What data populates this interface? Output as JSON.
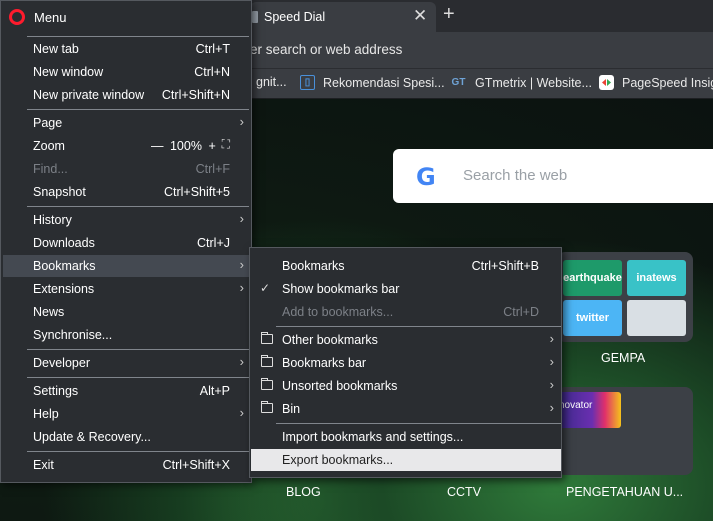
{
  "browser": {
    "tab_title": "Speed Dial",
    "tab_close": "✕",
    "new_tab_symbol": "+",
    "address_placeholder": "er search or web address",
    "bookmarks_bar": [
      {
        "label": "gnit...",
        "icon": "page-icon",
        "color": "#9aa3ad"
      },
      {
        "label": "Rekomendasi Spesi...",
        "icon": "doc-icon",
        "color": "#4a90d9"
      },
      {
        "label": "GTmetrix | Website...",
        "icon": "gtmetrix-icon",
        "glyph": "GT",
        "color": "#3a6ea5"
      },
      {
        "label": "PageSpeed Insigh",
        "icon": "pagespeed-icon",
        "color": "#34a853"
      }
    ]
  },
  "speed_dial": {
    "search_placeholder": "Search the web",
    "logo_letter": "G",
    "folder_tiles": [
      {
        "label": "earthquake",
        "color": "#1e9a6a"
      },
      {
        "label": "inatews",
        "color": "#39c2c7"
      },
      {
        "label": "twitter",
        "color": "#4cb5f5"
      },
      {
        "label": "",
        "color": "#d9dfe4"
      }
    ],
    "folder_label": "GEMPA",
    "innovator_text": "novator",
    "bottom_labels": [
      "BLOG",
      "CCTV",
      "PENGETAHUAN U..."
    ]
  },
  "menu": {
    "title": "Menu",
    "items": [
      {
        "label": "New tab",
        "shortcut": "Ctrl+T"
      },
      {
        "label": "New window",
        "shortcut": "Ctrl+N"
      },
      {
        "label": "New private window",
        "shortcut": "Ctrl+Shift+N"
      },
      {
        "label": "Page",
        "shortcut": ""
      },
      {
        "label": "Zoom",
        "shortcut": ""
      },
      {
        "label": "Find...",
        "shortcut": "Ctrl+F"
      },
      {
        "label": "Snapshot",
        "shortcut": "Ctrl+Shift+5"
      },
      {
        "label": "History",
        "shortcut": ""
      },
      {
        "label": "Downloads",
        "shortcut": "Ctrl+J"
      },
      {
        "label": "Bookmarks",
        "shortcut": ""
      },
      {
        "label": "Extensions",
        "shortcut": ""
      },
      {
        "label": "News",
        "shortcut": ""
      },
      {
        "label": "Synchronise...",
        "shortcut": ""
      },
      {
        "label": "Developer",
        "shortcut": ""
      },
      {
        "label": "Settings",
        "shortcut": "Alt+P"
      },
      {
        "label": "Help",
        "shortcut": ""
      },
      {
        "label": "Update & Recovery...",
        "shortcut": ""
      },
      {
        "label": "Exit",
        "shortcut": "Ctrl+Shift+X"
      }
    ],
    "zoom": {
      "minus": "—",
      "value": "100%",
      "plus": "+"
    }
  },
  "bookmarks_submenu": {
    "items": [
      {
        "label": "Bookmarks",
        "shortcut": "Ctrl+Shift+B"
      },
      {
        "label": "Show bookmarks bar",
        "shortcut": ""
      },
      {
        "label": "Add to bookmarks...",
        "shortcut": "Ctrl+D"
      },
      {
        "label": "Other bookmarks",
        "shortcut": ""
      },
      {
        "label": "Bookmarks bar",
        "shortcut": ""
      },
      {
        "label": "Unsorted bookmarks",
        "shortcut": ""
      },
      {
        "label": "Bin",
        "shortcut": ""
      },
      {
        "label": "Import bookmarks and settings...",
        "shortcut": ""
      },
      {
        "label": "Export bookmarks...",
        "shortcut": ""
      }
    ],
    "checkmark": "✓"
  },
  "colors": {
    "menu_bg": "#2a2d31",
    "menu_highlight": "#444951",
    "submenu_highlight": "#e8e8ea",
    "opera_red": "#ff1b2d"
  }
}
